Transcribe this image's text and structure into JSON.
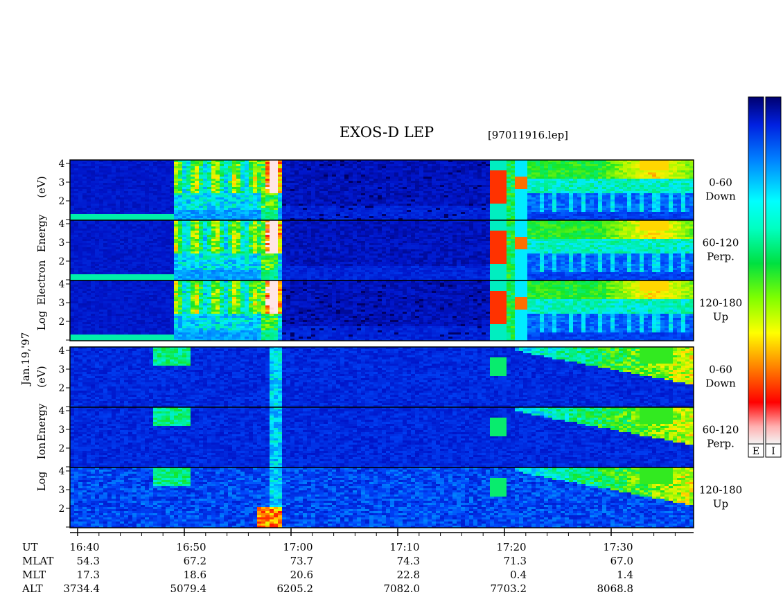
{
  "chart_data": {
    "type": "heatmap",
    "title": "EXOS-D LEP",
    "file_label": "[97011916.lep]",
    "date_label": "Jan.19,'97",
    "y_ticks": [
      "1",
      "2",
      "3",
      "4"
    ],
    "x_ticks": [
      "16:40",
      "16:50",
      "17:00",
      "17:10",
      "17:20",
      "17:30"
    ],
    "x_range": [
      "16:37",
      "17:38"
    ],
    "groups": [
      {
        "name": "Electron",
        "ylabel_words": [
          "Log",
          "Electron",
          "Energy",
          "(eV)"
        ],
        "panels": [
          {
            "pitch": "0-60",
            "direction": "Down"
          },
          {
            "pitch": "60-120",
            "direction": "Perp."
          },
          {
            "pitch": "120-180",
            "direction": "Up"
          }
        ]
      },
      {
        "name": "Ion",
        "ylabel_words": [
          "Log",
          "Ion",
          "Energy",
          "(eV)"
        ],
        "panels": [
          {
            "pitch": "0-60",
            "direction": "Down"
          },
          {
            "pitch": "60-120",
            "direction": "Perp."
          },
          {
            "pitch": "120-180",
            "direction": "Up"
          }
        ]
      }
    ],
    "ephemeris": {
      "labels": [
        "UT",
        "MLAT",
        "MLT",
        "ALT"
      ],
      "columns": [
        {
          "ut": "16:40",
          "mlat": "54.3",
          "mlt": "17.3",
          "alt": "3734.4"
        },
        {
          "ut": "16:50",
          "mlat": "67.2",
          "mlt": "18.6",
          "alt": "5079.4"
        },
        {
          "ut": "17:00",
          "mlat": "73.7",
          "mlt": "20.6",
          "alt": "6205.2"
        },
        {
          "ut": "17:10",
          "mlat": "74.3",
          "mlt": "22.8",
          "alt": "7082.0"
        },
        {
          "ut": "17:20",
          "mlat": "71.3",
          "mlt": "0.4",
          "alt": "7703.2"
        },
        {
          "ut": "17:30",
          "mlat": "67.0",
          "mlt": "1.4",
          "alt": "8068.8"
        }
      ]
    },
    "colorbars": [
      {
        "label": "E"
      },
      {
        "label": "I"
      }
    ],
    "colormap": [
      "#f4f4f4",
      "#ff0000",
      "#ff8000",
      "#ffff00",
      "#00e000",
      "#00ffff",
      "#0060ff",
      "#000080"
    ],
    "background_color": "#0a1aa0"
  }
}
